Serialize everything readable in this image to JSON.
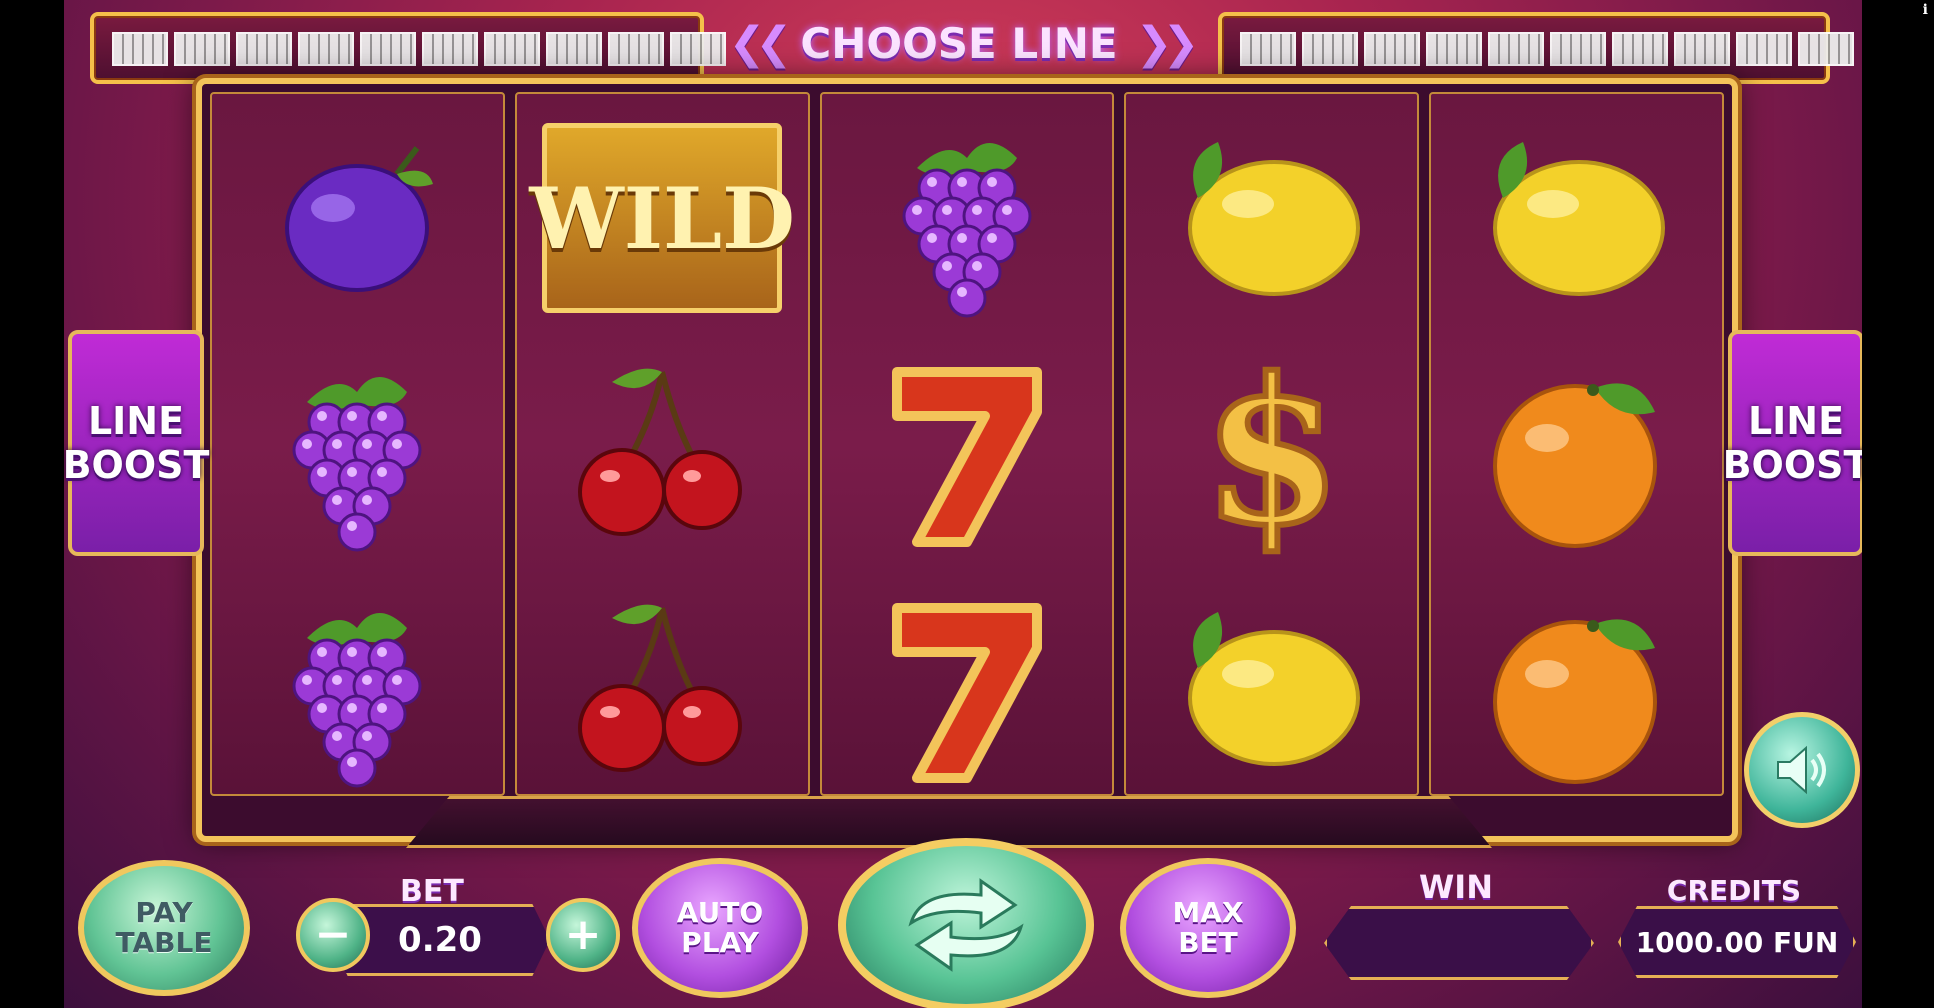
{
  "header": {
    "title": "CHOOSE LINE",
    "left_arrow_icon": "double-chevron-left-icon",
    "right_arrow_icon": "double-chevron-right-icon"
  },
  "line_indicators": {
    "left_count": 10,
    "right_count": 10
  },
  "reels": [
    [
      "plum",
      "grapes",
      "grapes"
    ],
    [
      "wild",
      "cherries",
      "cherries"
    ],
    [
      "grapes",
      "seven",
      "seven"
    ],
    [
      "lemon",
      "dollar",
      "lemon"
    ],
    [
      "lemon",
      "orange",
      "orange"
    ]
  ],
  "wild_label": "WILD",
  "line_boost": {
    "label_line1": "LINE",
    "label_line2": "BOOST"
  },
  "controls": {
    "pay_table_line1": "PAY",
    "pay_table_line2": "TABLE",
    "bet_label": "BET",
    "bet_value": "0.20",
    "minus": "−",
    "plus": "+",
    "auto_play_line1": "AUTO",
    "auto_play_line2": "PLAY",
    "spin_icon": "spin-arrows-icon",
    "max_bet_line1": "MAX",
    "max_bet_line2": "BET",
    "win_label": "WIN",
    "win_value": "",
    "credits_label": "CREDITS",
    "credits_value": "1000.00 FUN",
    "sound_icon": "speaker-icon",
    "info_icon": "i"
  },
  "colors": {
    "gold": "#f3c45a",
    "purple": "#b24fe0",
    "green": "#61c495",
    "background": "#a8244f"
  }
}
